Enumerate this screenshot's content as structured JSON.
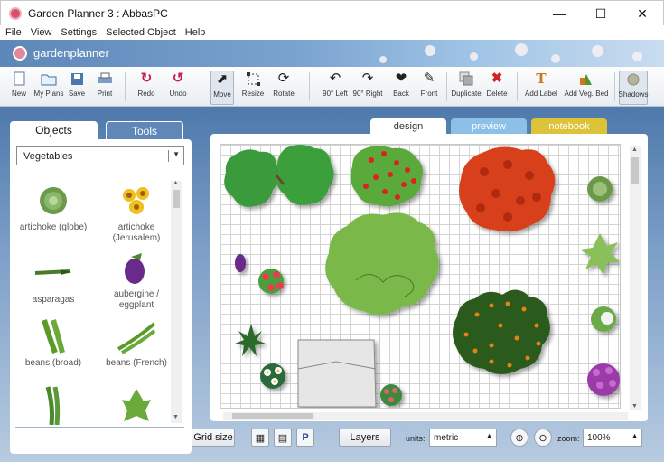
{
  "window": {
    "title": "Garden Planner 3 : AbbasPC",
    "controls": [
      "minimize",
      "maximize",
      "close"
    ]
  },
  "menu": [
    "File",
    "View",
    "Settings",
    "Selected Object",
    "Help"
  ],
  "banner": {
    "logo_text": "gardenplanner"
  },
  "toolbar": [
    {
      "label": "New",
      "icon": "new-file-icon"
    },
    {
      "label": "My Plans",
      "icon": "folder-icon"
    },
    {
      "label": "Save",
      "icon": "save-icon"
    },
    {
      "label": "Print",
      "icon": "print-icon"
    },
    {
      "label": "Redo",
      "icon": "redo-icon"
    },
    {
      "label": "Undo",
      "icon": "undo-icon"
    },
    {
      "label": "Move",
      "icon": "cursor-icon"
    },
    {
      "label": "Resize",
      "icon": "resize-icon"
    },
    {
      "label": "Rotate",
      "icon": "rotate-icon"
    },
    {
      "label": "90° Left",
      "icon": "rotate-left-icon"
    },
    {
      "label": "90° Right",
      "icon": "rotate-right-icon"
    },
    {
      "label": "Back",
      "icon": "back-icon"
    },
    {
      "label": "Front",
      "icon": "front-icon"
    },
    {
      "label": "Duplicate",
      "icon": "duplicate-icon"
    },
    {
      "label": "Delete",
      "icon": "delete-icon"
    },
    {
      "label": "Add Label",
      "icon": "text-icon"
    },
    {
      "label": "Add Veg. Bed",
      "icon": "veg-bed-icon"
    },
    {
      "label": "Shadows",
      "icon": "shadows-icon"
    }
  ],
  "left_panel": {
    "tabs": [
      "Objects",
      "Tools"
    ],
    "category": "Vegetables",
    "objects": [
      "artichoke (globe)",
      "artichoke (Jerusalem)",
      "asparagas",
      "aubergine / eggplant",
      "beans (broad)",
      "beans (French)",
      "",
      ""
    ]
  },
  "view_tabs": [
    "design",
    "preview",
    "notebook"
  ],
  "bottom_bar": {
    "grid_size": "Grid size",
    "grid_icons": [
      "grid-icon",
      "ruler-icon",
      "parking-icon"
    ],
    "parking_glyph": "P",
    "layers": "Layers",
    "units_label": "units:",
    "units_value": "metric",
    "zoom_in_icon": "zoom-in-icon",
    "zoom_out_icon": "zoom-out-icon",
    "zoom_label": "zoom:",
    "zoom_value": "100%"
  },
  "colors": {
    "banner": "#6b93c4",
    "workspace": "#5f88b8",
    "preview_tab": "#8cc0e6",
    "notebook_tab": "#dcc33a"
  }
}
